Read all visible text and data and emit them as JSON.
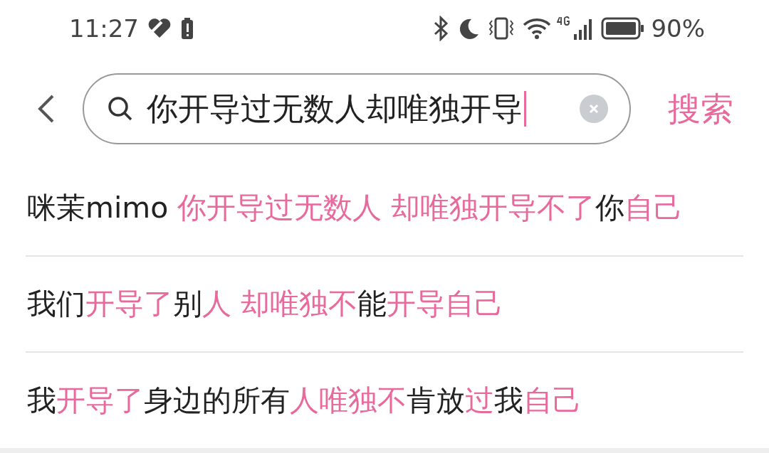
{
  "status_bar": {
    "time": "11:27",
    "battery": "90%"
  },
  "search": {
    "value": "你开导过无数人却唯独开导",
    "focused": true,
    "button": "搜索"
  },
  "suggestions": [
    {
      "segments": [
        {
          "text": "咪茉mimo ",
          "highlighted": false
        },
        {
          "text": "你开导过无数人 却唯独开导不了",
          "highlighted": true
        },
        {
          "text": "你",
          "highlighted": false
        },
        {
          "text": "自己",
          "highlighted": true
        }
      ]
    },
    {
      "segments": [
        {
          "text": "我们",
          "highlighted": false
        },
        {
          "text": "开导了",
          "highlighted": true
        },
        {
          "text": "别",
          "highlighted": false
        },
        {
          "text": "人 却唯独不",
          "highlighted": true
        },
        {
          "text": "能",
          "highlighted": false
        },
        {
          "text": "开导自己",
          "highlighted": true
        }
      ]
    },
    {
      "segments": [
        {
          "text": "我",
          "highlighted": false
        },
        {
          "text": "开导了",
          "highlighted": true
        },
        {
          "text": "身边的所有",
          "highlighted": false
        },
        {
          "text": "人唯独不",
          "highlighted": true
        },
        {
          "text": "肯放",
          "highlighted": false
        },
        {
          "text": "过",
          "highlighted": true
        },
        {
          "text": "我",
          "highlighted": false
        },
        {
          "text": "自己",
          "highlighted": true
        }
      ]
    }
  ]
}
